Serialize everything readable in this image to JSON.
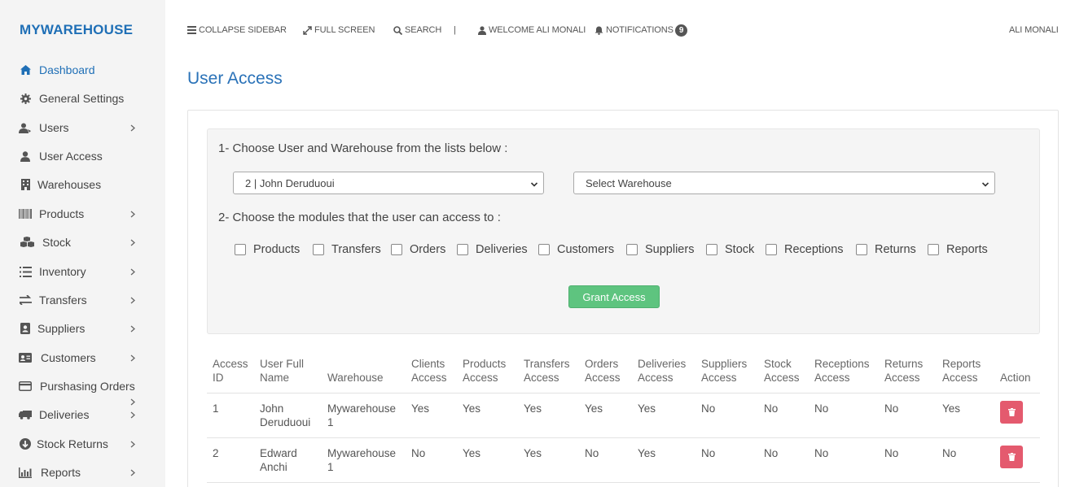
{
  "brand": "MYWAREHOUSE",
  "sidebar": {
    "items": [
      {
        "label": "Dashboard",
        "icon": "home-icon"
      },
      {
        "label": "General Settings",
        "icon": "gear-icon"
      },
      {
        "label": "Users",
        "icon": "users-icon"
      },
      {
        "label": "User Access",
        "icon": "user-icon"
      },
      {
        "label": "Warehouses",
        "icon": "building-icon"
      },
      {
        "label": "Products",
        "icon": "barcode-icon"
      },
      {
        "label": "Stock",
        "icon": "cubes-icon"
      },
      {
        "label": "Inventory",
        "icon": "list-icon"
      },
      {
        "label": "Transfers",
        "icon": "exchange-icon"
      },
      {
        "label": "Suppliers",
        "icon": "address-book-icon"
      },
      {
        "label": "Customers",
        "icon": "id-card-icon"
      },
      {
        "label": "Purshasing Orders",
        "icon": "credit-card-icon"
      },
      {
        "label": "Deliveries",
        "icon": "truck-icon"
      },
      {
        "label": "Stock Returns",
        "icon": "arrow-circle-down-icon"
      },
      {
        "label": "Reports",
        "icon": "bar-chart-icon"
      }
    ]
  },
  "topbar": {
    "collapse": "COLLAPSE SIDEBAR",
    "fullscreen": "FULL SCREEN",
    "search": "SEARCH",
    "separator": "|",
    "welcome": "WELCOME ALI MONALI",
    "notifications": "NOTIFICATIONS",
    "notif_count": "9",
    "user": "ALI MONALI"
  },
  "page": {
    "title": "User Access",
    "step1": "1- Choose User and Warehouse from the lists below :",
    "user_select": "2 | John Deruduoui",
    "warehouse_select": "Select Warehouse",
    "step2": "2- Choose the modules that the user can access to :",
    "modules": [
      "Products",
      "Transfers",
      "Orders",
      "Deliveries",
      "Customers",
      "Suppliers",
      "Stock",
      "Receptions",
      "Returns",
      "Reports"
    ],
    "grant_button": "Grant Access"
  },
  "table": {
    "headers": [
      [
        "Access",
        "ID"
      ],
      [
        "User Full",
        "Name"
      ],
      [
        "Warehouse"
      ],
      [
        "Clients",
        "Access"
      ],
      [
        "Products",
        "Access"
      ],
      [
        "Transfers",
        "Access"
      ],
      [
        "Orders",
        "Access"
      ],
      [
        "Deliveries",
        "Access"
      ],
      [
        "Suppliers",
        "Access"
      ],
      [
        "Stock",
        "Access"
      ],
      [
        "Receptions",
        "Access"
      ],
      [
        "Returns",
        "Access"
      ],
      [
        "Reports",
        "Access"
      ],
      [
        "Action"
      ]
    ],
    "rows": [
      {
        "id": "1",
        "name": [
          "John",
          "Deruduoui"
        ],
        "warehouse": [
          "Mywarehouse",
          "1"
        ],
        "values": [
          "Yes",
          "Yes",
          "Yes",
          "Yes",
          "Yes",
          "No",
          "No",
          "No",
          "No",
          "Yes"
        ]
      },
      {
        "id": "2",
        "name": [
          "Edward",
          "Anchi"
        ],
        "warehouse": [
          "Mywarehouse",
          "1"
        ],
        "values": [
          "No",
          "Yes",
          "Yes",
          "No",
          "Yes",
          "No",
          "No",
          "No",
          "No",
          "No"
        ]
      }
    ]
  },
  "colors": {
    "brand": "#1f6fb6",
    "title": "#2a72b8",
    "grant": "#5ec47f",
    "delete": "#e45a6e"
  }
}
